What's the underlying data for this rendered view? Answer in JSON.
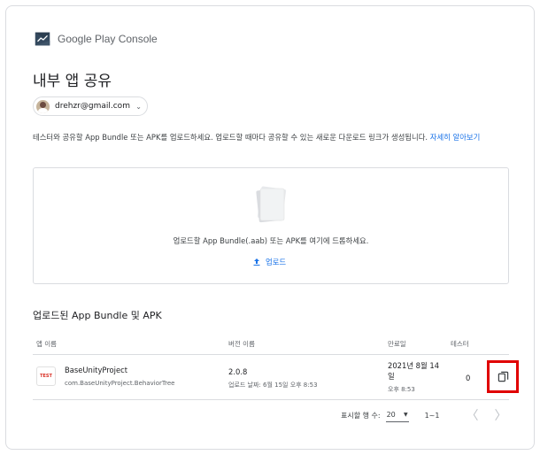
{
  "brand": {
    "name": "Google Play Console",
    "icon": "play-console-logo"
  },
  "page": {
    "title": "내부 앱 공유"
  },
  "account": {
    "email": "drehzr@gmail.com",
    "caret": "⌄"
  },
  "description": {
    "text": "테스터와 공유할 App Bundle 또는 APK를 업로드하세요. 업로드할 때마다 공유할 수 있는 새로운 다운로드 링크가 생성됩니다. ",
    "link": "자세히 알아보기"
  },
  "upload": {
    "prompt": "업로드할 App Bundle(.aab) 또는 APK를 여기에 드롭하세요.",
    "button_label": "업로드"
  },
  "uploaded": {
    "section_title": "업로드된 App Bundle 및 APK",
    "columns": {
      "app_name": "앱 이름",
      "version": "버전 이름",
      "expiry": "만료일",
      "testers": "테스터"
    },
    "rows": [
      {
        "icon_text": "TEST",
        "name": "BaseUnityProject",
        "package": "com.BaseUnityProject.BehaviorTree",
        "version": "2.0.8",
        "uploaded": "업로드 날짜: 6월 15일 오후 8:53",
        "expiry_date": "2021년 8월 14일",
        "expiry_time": "오후 8:53",
        "testers": "0"
      }
    ]
  },
  "pagination": {
    "rows_label": "표시할 행 수:",
    "rows_value": "20",
    "range": "1~1",
    "prev": "〈",
    "next": "〉"
  },
  "colors": {
    "accent": "#1a73e8",
    "highlight": "#e00000",
    "border": "#dadce0"
  }
}
